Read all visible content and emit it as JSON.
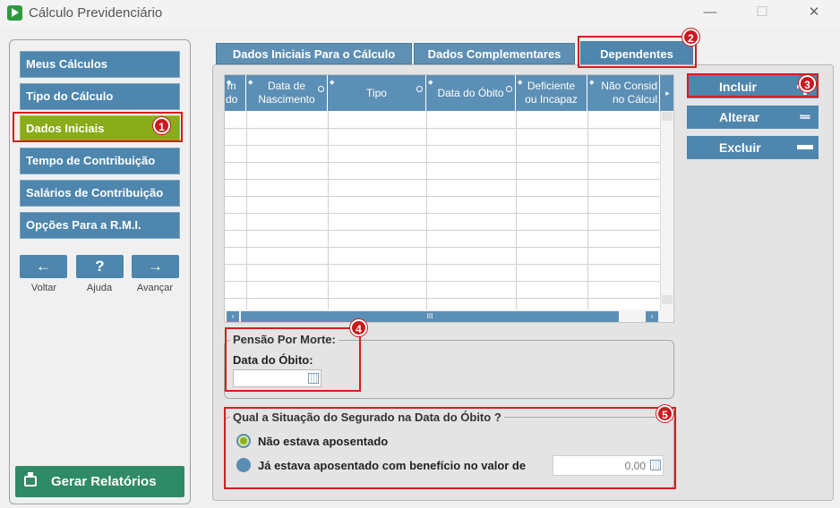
{
  "window": {
    "title": "Cálculo Previdenciário",
    "minimize": "—",
    "maximize": "☐",
    "close": "✕"
  },
  "sidebar": {
    "items": [
      {
        "label": "Meus Cálculos"
      },
      {
        "label": "Tipo do Cálculo"
      },
      {
        "label": "Dados Iniciais",
        "active": true
      },
      {
        "label": "Tempo de Contribuição"
      },
      {
        "label": "Salários de Contribuição"
      },
      {
        "label": "Opções Para a R.M.I."
      }
    ],
    "back": {
      "icon": "←",
      "label": "Voltar"
    },
    "help": {
      "icon": "?",
      "label": "Ajuda"
    },
    "forward": {
      "icon": "→",
      "label": "Avançar"
    },
    "report_label": "Gerar Relatórios"
  },
  "tabs": [
    {
      "label": "Dados Iniciais Para o Cálculo"
    },
    {
      "label": "Dados Complementares"
    },
    {
      "label": "Dependentes",
      "active": true
    }
  ],
  "grid": {
    "columns": [
      {
        "label": "m\ndo"
      },
      {
        "label": "Data de\nNascimento"
      },
      {
        "label": "Tipo"
      },
      {
        "label": "Data do Óbito"
      },
      {
        "label": "Deficiente\nou Incapaz"
      },
      {
        "label": "Não Consid\nno Cálcul"
      }
    ],
    "scroll_right": "▸",
    "scroll_thumb": "III",
    "scroll_left": "‹",
    "scroll_right_btn": "›"
  },
  "actions": {
    "add": "Incluir",
    "edit": "Alterar",
    "remove": "Excluir",
    "edit_icon": "≔"
  },
  "pensao": {
    "legend": "Pensão Por Morte:",
    "date_label": "Data do Óbito:",
    "date_value": ""
  },
  "situacao": {
    "legend": "Qual a Situação do Segurado na Data do Óbito ?",
    "option1": "Não estava aposentado",
    "option2": "Já estava aposentado com benefício no valor de",
    "selected": "option1",
    "value": "0,00"
  },
  "annotations": [
    "1",
    "2",
    "3",
    "4",
    "5"
  ],
  "colors": {
    "nav_blue": "#4e86ad",
    "active_green": "#8aab1a",
    "report_green": "#2f8a67",
    "highlight_red": "#d41e1e"
  }
}
